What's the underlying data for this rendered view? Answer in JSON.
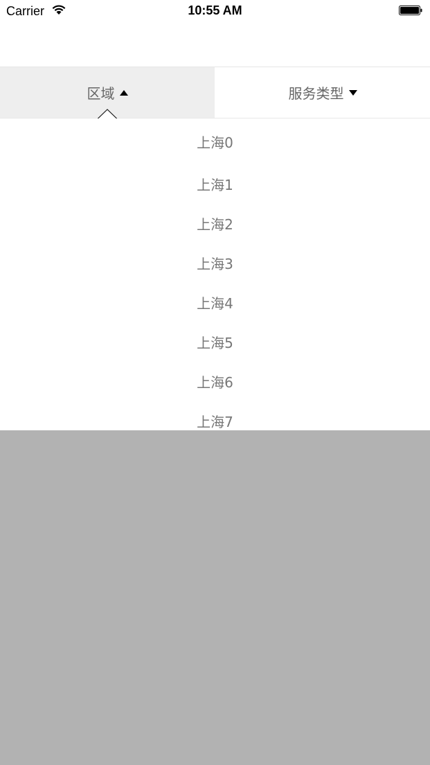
{
  "status_bar": {
    "carrier": "Carrier",
    "time": "10:55 AM",
    "wifi_icon": "wifi-icon",
    "battery_icon": "battery-icon"
  },
  "filter_bar": {
    "tabs": [
      {
        "label": "区域",
        "indicator": "triangle-up-icon",
        "active": true
      },
      {
        "label": "服务类型",
        "indicator": "triangle-down-icon",
        "active": false
      }
    ]
  },
  "dropdown": {
    "items": [
      "上海0",
      "上海1",
      "上海2",
      "上海3",
      "上海4",
      "上海5",
      "上海6",
      "上海7"
    ]
  },
  "colors": {
    "active_tab_bg": "#eeeeee",
    "overlay": "#b2b2b2",
    "item_text": "#777777"
  }
}
